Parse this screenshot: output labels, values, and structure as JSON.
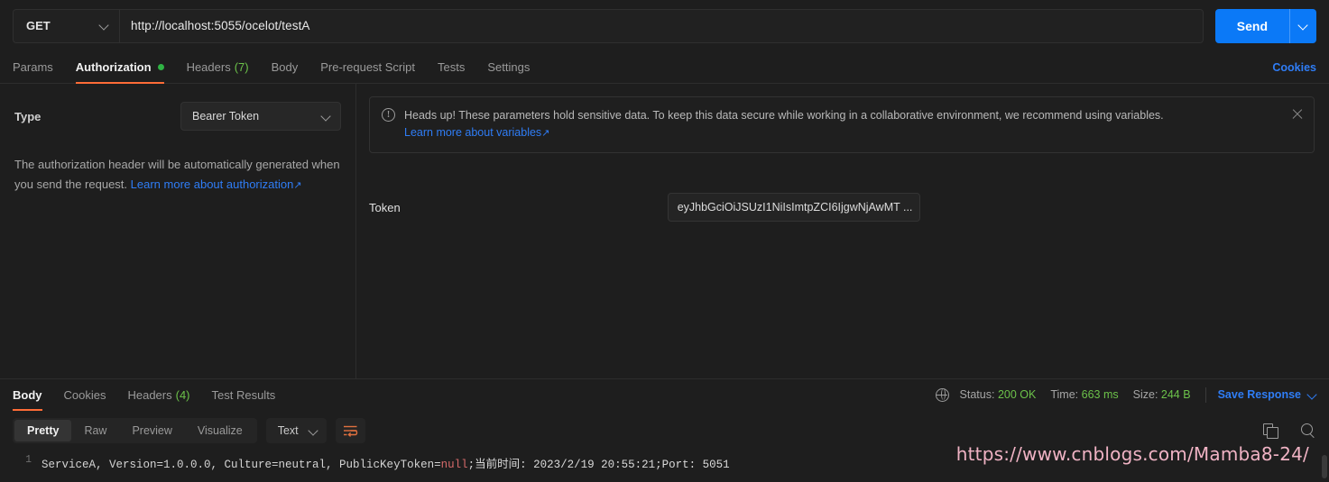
{
  "request_bar": {
    "method": "GET",
    "method_caret_icon": "chevron-down-icon",
    "url": "http://localhost:5055/ocelot/testA",
    "send_label": "Send",
    "send_caret_icon": "chevron-down-icon",
    "accent_blue": "#0b79f7"
  },
  "request_tabs": {
    "items": [
      {
        "label": "Params",
        "active": false
      },
      {
        "label": "Authorization",
        "active": true,
        "badge_dot": true
      },
      {
        "label": "Headers",
        "active": false,
        "count": "(7)"
      },
      {
        "label": "Body",
        "active": false
      },
      {
        "label": "Pre-request Script",
        "active": false
      },
      {
        "label": "Tests",
        "active": false
      },
      {
        "label": "Settings",
        "active": false
      }
    ],
    "cookies_link": "Cookies",
    "active_underline_color": "#ff6c37",
    "dot_color": "#2fb344"
  },
  "authorization": {
    "type_label": "Type",
    "type_value": "Bearer Token",
    "type_caret_icon": "chevron-down-icon",
    "help_text": "The authorization header will be automatically generated when you send the request. ",
    "help_link": "Learn more about authorization",
    "help_link_arrow": "↗",
    "notice": {
      "icon": "alert-circle-icon",
      "text": "Heads up! These parameters hold sensitive data. To keep this data secure while working in a collaborative environment, we recommend using variables.",
      "link": "Learn more about variables",
      "link_arrow": "↗",
      "close_icon": "close-icon"
    },
    "token_label": "Token",
    "token_value": "eyJhbGciOiJSUzI1NiIsImtpZCI6IjgwNjAwMT ..."
  },
  "response_tabs": {
    "items": [
      {
        "label": "Body",
        "active": true
      },
      {
        "label": "Cookies",
        "active": false
      },
      {
        "label": "Headers",
        "active": false,
        "count": "(4)"
      },
      {
        "label": "Test Results",
        "active": false
      }
    ],
    "globe_icon": "globe-icon",
    "status_label": "Status:",
    "status_value": "200 OK",
    "time_label": "Time:",
    "time_value": "663 ms",
    "size_label": "Size:",
    "size_value": "244 B",
    "save_response_label": "Save Response",
    "save_caret_icon": "chevron-down-icon",
    "success_color": "#6cc24a",
    "link_color": "#2f7df6"
  },
  "body_toolbar": {
    "views": [
      {
        "label": "Pretty",
        "active": true
      },
      {
        "label": "Raw",
        "active": false
      },
      {
        "label": "Preview",
        "active": false
      },
      {
        "label": "Visualize",
        "active": false
      }
    ],
    "format_value": "Text",
    "format_caret_icon": "chevron-down-icon",
    "wrap_icon": "word-wrap-icon",
    "copy_icon": "copy-icon",
    "search_icon": "search-icon"
  },
  "response_body": {
    "line_number": "1",
    "text_before_null": "ServiceA, Version=1.0.0.0, Culture=neutral, PublicKeyToken=",
    "text_null": "null",
    "text_after_null": ";当前时间: 2023/2/19 20:55:21;Port: 5051"
  },
  "watermark": {
    "url": "https://www.cnblogs.com/Mamba8-24/",
    "color": "#f0b3c4"
  }
}
